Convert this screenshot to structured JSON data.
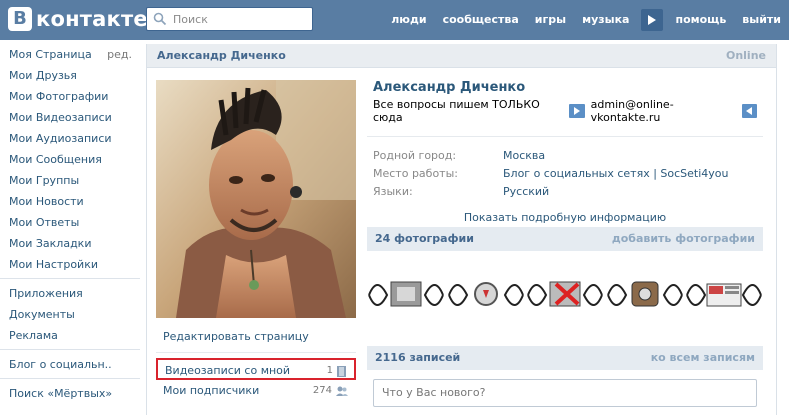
{
  "header": {
    "logo_letter": "В",
    "logo_text": "контакте",
    "search_placeholder": "Поиск",
    "nav": [
      "люди",
      "сообщества",
      "игры",
      "музыка",
      "помощь",
      "выйти"
    ]
  },
  "sidebar": {
    "my_page": "Моя Страница",
    "edit": "ред.",
    "group1": [
      "Мои Друзья",
      "Мои Фотографии",
      "Мои Видеозаписи",
      "Мои Аудиозаписи",
      "Мои Сообщения",
      "Мои Группы",
      "Мои Новости",
      "Мои Ответы",
      "Мои Закладки",
      "Мои Настройки"
    ],
    "group2": [
      "Приложения",
      "Документы",
      "Реклама"
    ],
    "group3": [
      "Блог о социальн.."
    ],
    "group4": [
      "Поиск «Мёртвых»"
    ]
  },
  "profile": {
    "header_name": "Александр Диченко",
    "online": "Online",
    "full_name": "Александр Диченко",
    "status_text": "Все вопросы пишем ТОЛЬКО сюда",
    "status_email": "admin@online-vkontakte.ru",
    "fields": [
      {
        "label": "Родной город:",
        "value": "Москва"
      },
      {
        "label": "Место работы:",
        "value": "Блог о социальных сетях | SocSeti4you"
      },
      {
        "label": "Языки:",
        "value": "Русский"
      }
    ],
    "show_more": "Показать подробную информацию",
    "edit_page": "Редактировать страницу",
    "videos_with_me": "Видеозаписи со мной",
    "videos_count": "1",
    "subscribers": "Мои подписчики",
    "subscribers_count": "274"
  },
  "photos_block": {
    "title": "24 фотографии",
    "action": "добавить фотографии"
  },
  "wall_block": {
    "title": "2116 записей",
    "action": "ко всем записям",
    "input_placeholder": "Что у Вас нового?"
  },
  "colors": {
    "header": "#597da3",
    "link": "#2b587a",
    "highlight": "#d9232d"
  }
}
